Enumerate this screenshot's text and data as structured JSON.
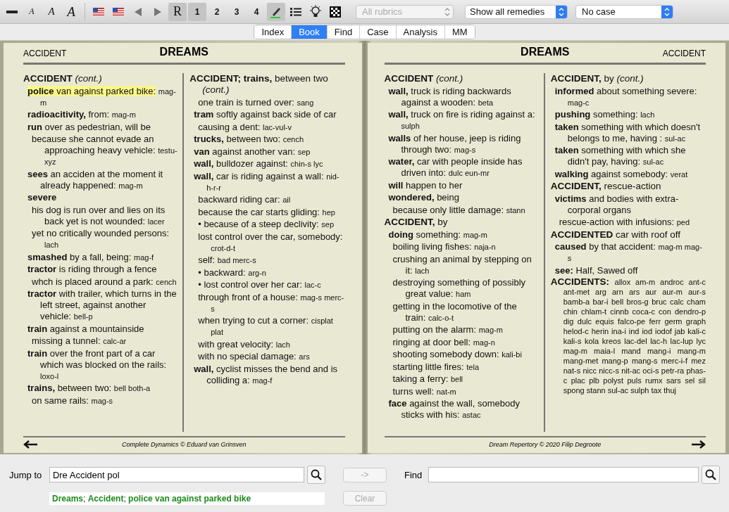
{
  "toolbar": {
    "font_sizes": [
      "A",
      "A",
      "A"
    ],
    "views": [
      {
        "label": "R",
        "pressed": true
      },
      {
        "label": "1",
        "pressed": true
      },
      {
        "label": "2",
        "pressed": false
      },
      {
        "label": "3",
        "pressed": false
      },
      {
        "label": "4",
        "pressed": false
      }
    ],
    "highlight_pressed": true,
    "dropdowns": [
      {
        "value": "All rubrics",
        "disabled": true
      },
      {
        "value": "Show all remedies",
        "disabled": false
      },
      {
        "value": "No case",
        "disabled": false
      }
    ]
  },
  "tabs": [
    {
      "label": "Index",
      "selected": false
    },
    {
      "label": "Book",
      "selected": true
    },
    {
      "label": "Find",
      "selected": false
    },
    {
      "label": "Case",
      "selected": false
    },
    {
      "label": "Analysis",
      "selected": false
    },
    {
      "label": "MM",
      "selected": false
    }
  ],
  "pages": [
    {
      "section": "ACCIDENT",
      "chapter": "DREAMS",
      "footer": "Complete Dynamics © Eduard van Grinsven",
      "columns": [
        {
          "entries": [
            {
              "kind": "heading",
              "text": "**ACCIDENT** *(cont.)*",
              "selected": false
            },
            {
              "kind": "rubric",
              "text": "**police** van against parked bike:",
              "remedies": "mag-m",
              "selected": true
            },
            {
              "kind": "rubric",
              "text": "**radioacitivity,** from:",
              "remedies": "mag-m",
              "selected": false
            },
            {
              "kind": "rubric",
              "text": "**run** over as pedestrian, will be",
              "selected": false
            },
            {
              "kind": "sub",
              "text": "because she cannot evade an approaching heavy vehicle:",
              "remedies": "testu-xyz",
              "selected": false
            },
            {
              "kind": "rubric",
              "text": "**sees** an acciden at the moment it already happened:",
              "remedies": "mag-m",
              "selected": false
            },
            {
              "kind": "rubric",
              "text": "**severe**",
              "selected": false
            },
            {
              "kind": "sub",
              "text": "his dog is run over and lies on its back yet is not wounded:",
              "remedies": "lacer",
              "selected": false
            },
            {
              "kind": "sub",
              "text": "yet no critically wounded persons:",
              "remedies": "lach",
              "selected": false
            },
            {
              "kind": "rubric",
              "text": "**smashed** by a fall, being:",
              "remedies": "mag-f",
              "selected": false
            },
            {
              "kind": "rubric",
              "text": "**tractor** is riding through a fence",
              "selected": false
            },
            {
              "kind": "sub",
              "text": "whch is placed around a park:",
              "remedies": "cench",
              "selected": false
            },
            {
              "kind": "rubric",
              "text": "**tractor** with trailer, which turns in the left street, against another vehicle:",
              "remedies": "bell-p",
              "selected": false
            },
            {
              "kind": "rubric",
              "text": "**train** against a mountainside",
              "selected": false
            },
            {
              "kind": "sub",
              "text": "missing a tunnel:",
              "remedies": "calc-ar",
              "selected": false
            },
            {
              "kind": "rubric",
              "text": "**train** over the front part of a car which was blocked on the rails:",
              "remedies": "loxo-l",
              "selected": false
            },
            {
              "kind": "rubric",
              "text": "**trains,** between two:",
              "remedies": "bell both-a",
              "selected": false
            },
            {
              "kind": "sub",
              "text": "on same rails:",
              "remedies": "mag-s",
              "selected": false
            }
          ]
        },
        {
          "entries": [
            {
              "kind": "heading",
              "text": "**ACCIDENT; trains,** between two *(cont.)*",
              "selected": false
            },
            {
              "kind": "sub",
              "text": "one train is turned over:",
              "remedies": "sang",
              "selected": false
            },
            {
              "kind": "rubric",
              "text": "**tram** softly against back side of car",
              "selected": false
            },
            {
              "kind": "sub",
              "text": "causing a dent:",
              "remedies": "lac-vul-v",
              "selected": false
            },
            {
              "kind": "rubric",
              "text": "**trucks,** between two:",
              "remedies": "cench",
              "selected": false
            },
            {
              "kind": "rubric",
              "text": "**van** against another van:",
              "remedies": "sep",
              "selected": false
            },
            {
              "kind": "rubric",
              "text": "**wall,** bulldozer against:",
              "remedies": "chin-s lyc",
              "selected": false
            },
            {
              "kind": "rubric",
              "text": "**wall,** car is riding against a wall:",
              "remedies": "nid-h-r-r",
              "selected": false
            },
            {
              "kind": "sub",
              "text": "backward riding car:",
              "remedies": "ail",
              "selected": false
            },
            {
              "kind": "sub",
              "text": "because the car starts gliding:",
              "remedies": "hep",
              "selected": false
            },
            {
              "kind": "sub",
              "text": "• because of a steep declivity:",
              "remedies": "sep",
              "selected": false
            },
            {
              "kind": "sub",
              "text": "lost control over the car, somebody:",
              "remedies": "crot-d-t",
              "selected": false
            },
            {
              "kind": "sub",
              "text": "self:",
              "remedies": "bad merc-s",
              "selected": false
            },
            {
              "kind": "sub",
              "text": "• backward:",
              "remedies": "arg-n",
              "selected": false
            },
            {
              "kind": "sub",
              "text": "• lost control over her car:",
              "remedies": "lac-c",
              "selected": false
            },
            {
              "kind": "sub",
              "text": "through front of a house:",
              "remedies": "mag-s merc-s",
              "selected": false
            },
            {
              "kind": "sub",
              "text": "when trying to cut a corner:",
              "remedies": "cisplat plat",
              "selected": false
            },
            {
              "kind": "sub",
              "text": "with great velocity:",
              "remedies": "lach",
              "selected": false
            },
            {
              "kind": "sub",
              "text": "with no special damage:",
              "remedies": "ars",
              "selected": false
            },
            {
              "kind": "rubric",
              "text": "**wall,** cyclist misses the bend and is colliding a:",
              "remedies": "mag-f",
              "selected": false
            }
          ]
        }
      ]
    },
    {
      "section": "ACCIDENT",
      "chapter": "DREAMS",
      "footer": "Dream Repertory © 2020 Filip Degroote",
      "columns": [
        {
          "entries": [
            {
              "kind": "heading",
              "text": "**ACCIDENT** *(cont.)*",
              "selected": false
            },
            {
              "kind": "rubric",
              "text": "**wall,** truck  is riding backwards against a wooden:",
              "remedies": "beta",
              "selected": false
            },
            {
              "kind": "rubric",
              "text": "**wall,** truck on fire is riding against a:",
              "remedies": "sulph",
              "selected": false
            },
            {
              "kind": "rubric",
              "text": "**walls** of her house, jeep is riding through two:",
              "remedies": "mag-s",
              "selected": false
            },
            {
              "kind": "rubric",
              "text": "**water,** car with people inside has driven into:",
              "remedies": "dulc eun-mr",
              "selected": false
            },
            {
              "kind": "rubric",
              "text": "**will** happen to her",
              "selected": false
            },
            {
              "kind": "rubric",
              "text": "**wondered,** being",
              "selected": false
            },
            {
              "kind": "sub",
              "text": "because only little damage:",
              "remedies": "stann",
              "selected": false
            },
            {
              "kind": "heading",
              "text": "**ACCIDENT,** by",
              "selected": false
            },
            {
              "kind": "rubric",
              "text": "**doing** something:",
              "remedies": "mag-m",
              "selected": false
            },
            {
              "kind": "sub",
              "text": "boiling living fishes:",
              "remedies": "naja-n",
              "selected": false
            },
            {
              "kind": "sub",
              "text": "crushing an animal by stepping on it:",
              "remedies": "lach",
              "selected": false
            },
            {
              "kind": "sub",
              "text": "destroying something of possibly great value:",
              "remedies": "ham",
              "selected": false
            },
            {
              "kind": "sub",
              "text": "getting in the locomotive of the train:",
              "remedies": "calc-o-t",
              "selected": false
            },
            {
              "kind": "sub",
              "text": "putting on the alarm:",
              "remedies": "mag-m",
              "selected": false
            },
            {
              "kind": "sub",
              "text": "ringing at door bell:",
              "remedies": "mag-n",
              "selected": false
            },
            {
              "kind": "sub",
              "text": "shooting somebody down:",
              "remedies": "kali-bi",
              "selected": false
            },
            {
              "kind": "sub",
              "text": "starting little fires:",
              "remedies": "tela",
              "selected": false
            },
            {
              "kind": "sub",
              "text": "taking a ferry:",
              "remedies": "bell",
              "selected": false
            },
            {
              "kind": "sub",
              "text": "turns well:",
              "remedies": "nat-m",
              "selected": false
            },
            {
              "kind": "rubric",
              "text": "**face** against the wall, somebody sticks with his:",
              "remedies": "astac",
              "selected": false
            }
          ]
        },
        {
          "entries": [
            {
              "kind": "heading",
              "text": "**ACCIDENT,** by *(cont.)*",
              "selected": false
            },
            {
              "kind": "rubric",
              "text": "**informed** about something severe:",
              "remedies": "mag-c",
              "selected": false
            },
            {
              "kind": "rubric",
              "text": "**pushing** something:",
              "remedies": "lach",
              "selected": false
            },
            {
              "kind": "rubric",
              "text": "**taken** something with which doesn't belongs to me, having :",
              "remedies": "sul-ac",
              "selected": false
            },
            {
              "kind": "rubric",
              "text": "**taken** something with which she didn't pay, having:",
              "remedies": "sul-ac",
              "selected": false
            },
            {
              "kind": "rubric",
              "text": "**walking** against somebody:",
              "remedies": "verat",
              "selected": false
            },
            {
              "kind": "heading",
              "text": "**ACCIDENT,** rescue-action",
              "selected": false
            },
            {
              "kind": "rubric",
              "text": "**victims** and bodies with extra-corporal organs",
              "selected": false
            },
            {
              "kind": "sub",
              "text": "rescue-action with infusions:",
              "remedies": "ped",
              "selected": false
            },
            {
              "kind": "heading",
              "text": "**ACCIDENTED** car with roof off",
              "selected": false
            },
            {
              "kind": "rubric",
              "text": "**caused** by that accident:",
              "remedies": "mag-m mag-s",
              "selected": false
            },
            {
              "kind": "rubric",
              "text": "**see:** Half, Sawed off",
              "selected": false
            },
            {
              "kind": "heading",
              "text": "**ACCIDENTS:**",
              "remedies": "allox am-m androc ant-c ant-met arg arn ars aur aur-m aur-s bamb-a bar-i bell bros-g bruc calc cham chin chlam-t cinnb coca-c con dendro-p dig dulc equis falco-pe ferr germ graph helod-c herin ina-i ind iod iodof jab kali-c kali-s kola kreos lac-del lac-h lac-lup lyc mag-m maia-l mand mang-i mang-m mang-met mang-p mang-s merc-i-f mez nat-s nicc nicc-s nit-ac oci-s petr-ra phas-c plac plb polyst puls rumx sars sel sil spong stann sul-ac sulph tax thuj",
              "selected": false
            }
          ]
        }
      ]
    }
  ],
  "jump": {
    "label": "Jump to",
    "value": "Dre Accident pol",
    "path": "**Dreams**; **Accident**; **police van against parked bike**",
    "go_button": {
      "label": "->",
      "disabled": true
    },
    "clear_button": {
      "label": "Clear",
      "disabled": true
    }
  },
  "find": {
    "label": "Find"
  }
}
